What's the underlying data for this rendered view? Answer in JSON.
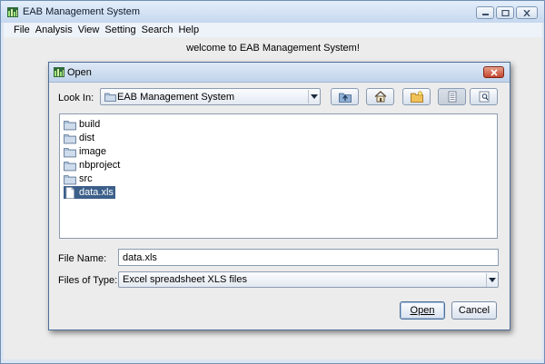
{
  "window": {
    "title": "EAB Management System",
    "icon": "app-icon"
  },
  "menu": [
    "File",
    "Analysis",
    "View",
    "Setting",
    "Search",
    "Help"
  ],
  "welcome": "welcome to EAB Management System!",
  "dialog": {
    "title": "Open",
    "look_in_label": "Look In:",
    "look_in_value": "EAB Management System",
    "toolbar_icons": [
      "up-one-level-icon",
      "home-icon",
      "new-folder-icon",
      "list-view-icon",
      "details-view-icon"
    ],
    "files": [
      {
        "name": "build",
        "type": "folder",
        "selected": false
      },
      {
        "name": "dist",
        "type": "folder",
        "selected": false
      },
      {
        "name": "image",
        "type": "folder",
        "selected": false
      },
      {
        "name": "nbproject",
        "type": "folder",
        "selected": false
      },
      {
        "name": "src",
        "type": "folder",
        "selected": false
      },
      {
        "name": "data.xls",
        "type": "file",
        "selected": true
      }
    ],
    "file_name_label": "File Name:",
    "file_name_value": "data.xls",
    "file_type_label": "Files of Type:",
    "file_type_value": "Excel spreadsheet XLS files",
    "open_label": "Open",
    "cancel_label": "Cancel"
  },
  "colors": {
    "selection": "#3c5f8a",
    "titlebar": "#c6d8ef",
    "close_button": "#c5442c"
  }
}
